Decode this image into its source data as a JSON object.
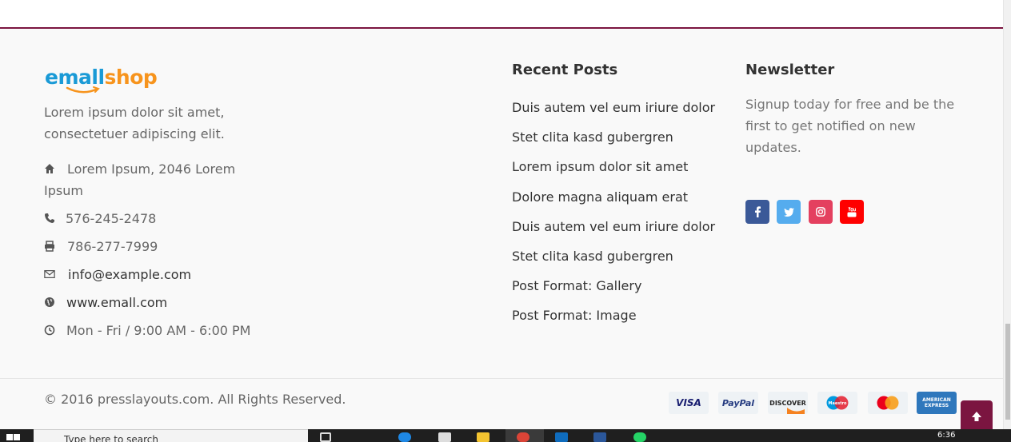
{
  "brand": {
    "logo_part1": "emall",
    "logo_part2": "shop"
  },
  "about": {
    "text": "Lorem ipsum dolor sit amet, consectetuer adipiscing elit."
  },
  "contact": {
    "address": "Lorem Ipsum, 2046 Lorem Ipsum",
    "phone": "576-245-2478",
    "fax": "786-277-7999",
    "email": "info@example.com",
    "website": "www.emall.com",
    "hours": "Mon - Fri / 9:00 AM - 6:00 PM"
  },
  "recent_posts": {
    "title": "Recent Posts",
    "items": [
      "Duis autem vel eum iriure dolor",
      "Stet clita kasd gubergren",
      "Lorem ipsum dolor sit amet",
      "Dolore magna aliquam erat",
      "Duis autem vel eum iriure dolor",
      "Stet clita kasd gubergren",
      "Post Format: Gallery",
      "Post Format: Image"
    ]
  },
  "newsletter": {
    "title": "Newsletter",
    "text": "Signup today for free and be the first to get notified on new updates."
  },
  "social": [
    {
      "name": "facebook",
      "color": "#3b5998"
    },
    {
      "name": "twitter",
      "color": "#55acee"
    },
    {
      "name": "instagram",
      "color": "#e4405f"
    },
    {
      "name": "youtube",
      "color": "#ff0000"
    }
  ],
  "copyright": "© 2016 presslayouts.com. All Rights Reserved.",
  "payments": {
    "visa": "VISA",
    "paypal": "PayPal",
    "discover": "DISCOVER",
    "amex": "AMERICAN EXPRESS"
  },
  "taskbar": {
    "search_placeholder": "Type here to search",
    "time": "6:36"
  },
  "colors": {
    "accent": "#7b1540",
    "logo_blue": "#1a9ad6",
    "logo_orange": "#f7941d"
  }
}
